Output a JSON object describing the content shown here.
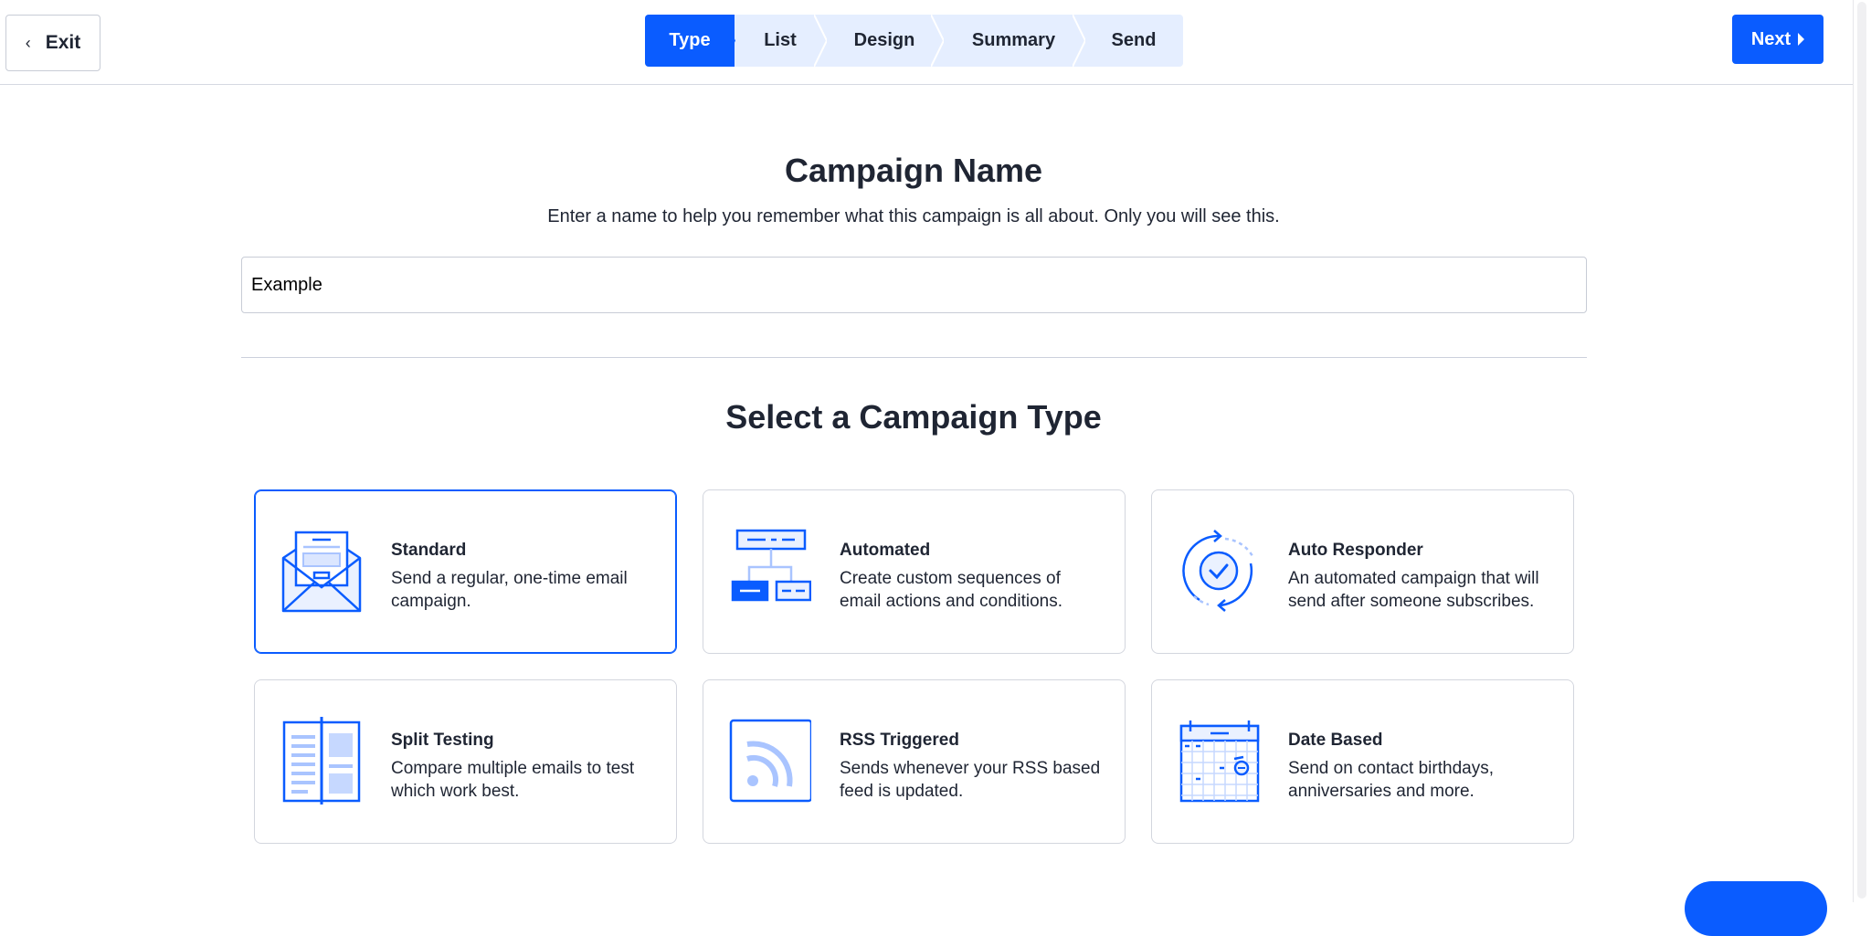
{
  "header": {
    "exit_label": "Exit",
    "next_label": "Next",
    "steps": [
      {
        "label": "Type",
        "active": true
      },
      {
        "label": "List",
        "active": false
      },
      {
        "label": "Design",
        "active": false
      },
      {
        "label": "Summary",
        "active": false
      },
      {
        "label": "Send",
        "active": false
      }
    ]
  },
  "campaign_name": {
    "title": "Campaign Name",
    "subtitle": "Enter a name to help you remember what this campaign is all about. Only you will see this.",
    "value": "Example"
  },
  "campaign_type": {
    "title": "Select a Campaign Type",
    "cards": [
      {
        "label": "Standard",
        "desc": "Send a regular, one-time email campaign.",
        "icon": "envelope-icon",
        "selected": true
      },
      {
        "label": "Automated",
        "desc": "Create custom sequences of email actions and conditions.",
        "icon": "workflow-icon",
        "selected": false
      },
      {
        "label": "Auto Responder",
        "desc": "An automated campaign that will send after someone subscribes.",
        "icon": "cycle-check-icon",
        "selected": false
      },
      {
        "label": "Split Testing",
        "desc": "Compare multiple emails to test which work best.",
        "icon": "split-document-icon",
        "selected": false
      },
      {
        "label": "RSS Triggered",
        "desc": "Sends whenever your RSS based feed is updated.",
        "icon": "rss-icon",
        "selected": false
      },
      {
        "label": "Date Based",
        "desc": "Send on contact birthdays, anniversaries and more.",
        "icon": "calendar-icon",
        "selected": false
      }
    ]
  },
  "colors": {
    "accent": "#0a5cff",
    "step_bg": "#e5eeff",
    "text": "#1f2533",
    "border": "#d3d6de"
  }
}
